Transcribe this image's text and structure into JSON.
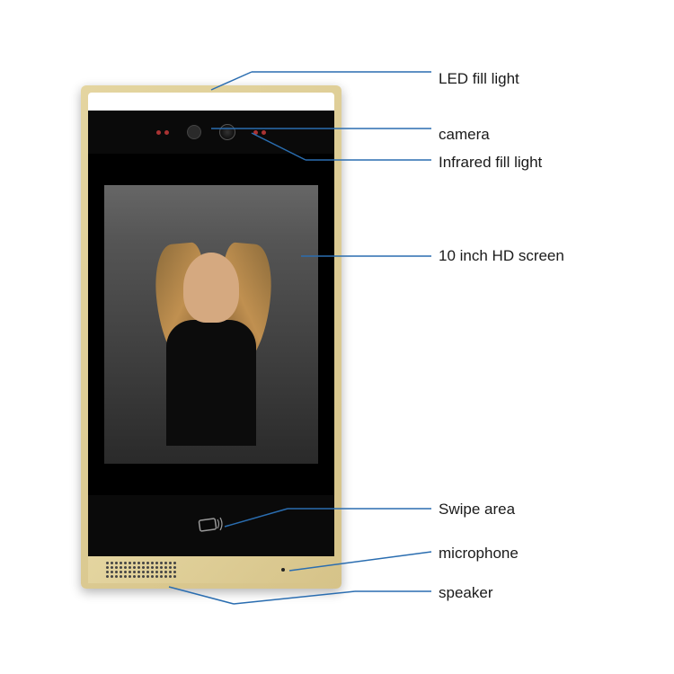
{
  "labels": {
    "led": "LED fill light",
    "camera": "camera",
    "infrared": "Infrared fill light",
    "screen": "10 inch HD screen",
    "swipe": "Swipe area",
    "mic": "microphone",
    "speaker": "speaker"
  }
}
